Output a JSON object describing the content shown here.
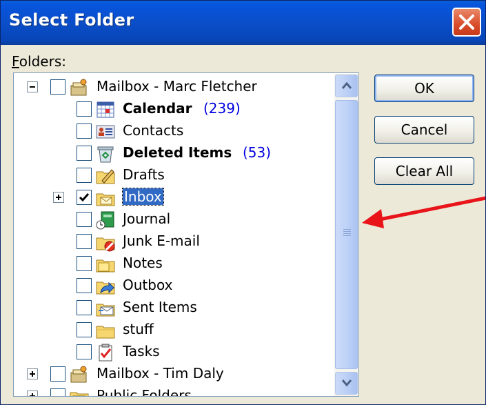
{
  "window": {
    "title": "Select Folder"
  },
  "folders_label": {
    "accel": "F",
    "rest": "olders:"
  },
  "tree": [
    {
      "label": "Mailbox - Marc Fletcher",
      "count": "",
      "bold": false,
      "expander": "minus",
      "checked": false,
      "level": 0,
      "icon": "mailbox-icon",
      "selected": false
    },
    {
      "label": "Calendar",
      "count": "(239)",
      "bold": true,
      "expander": "",
      "checked": false,
      "level": 1,
      "icon": "calendar-icon",
      "selected": false
    },
    {
      "label": "Contacts",
      "count": "",
      "bold": false,
      "expander": "",
      "checked": false,
      "level": 1,
      "icon": "contacts-icon",
      "selected": false
    },
    {
      "label": "Deleted Items",
      "count": "(53)",
      "bold": true,
      "expander": "",
      "checked": false,
      "level": 1,
      "icon": "trash-icon",
      "selected": false
    },
    {
      "label": "Drafts",
      "count": "",
      "bold": false,
      "expander": "",
      "checked": false,
      "level": 1,
      "icon": "drafts-icon",
      "selected": false
    },
    {
      "label": "Inbox",
      "count": "",
      "bold": false,
      "expander": "plus",
      "checked": true,
      "level": 1,
      "icon": "inbox-icon",
      "selected": true
    },
    {
      "label": "Journal",
      "count": "",
      "bold": false,
      "expander": "",
      "checked": false,
      "level": 1,
      "icon": "journal-icon",
      "selected": false
    },
    {
      "label": "Junk E-mail",
      "count": "",
      "bold": false,
      "expander": "",
      "checked": false,
      "level": 1,
      "icon": "junk-folder-icon",
      "selected": false
    },
    {
      "label": "Notes",
      "count": "",
      "bold": false,
      "expander": "",
      "checked": false,
      "level": 1,
      "icon": "notes-icon",
      "selected": false
    },
    {
      "label": "Outbox",
      "count": "",
      "bold": false,
      "expander": "",
      "checked": false,
      "level": 1,
      "icon": "outbox-icon",
      "selected": false
    },
    {
      "label": "Sent Items",
      "count": "",
      "bold": false,
      "expander": "",
      "checked": false,
      "level": 1,
      "icon": "sent-items-icon",
      "selected": false
    },
    {
      "label": "stuff",
      "count": "",
      "bold": false,
      "expander": "",
      "checked": false,
      "level": 1,
      "icon": "folder-icon",
      "selected": false
    },
    {
      "label": "Tasks",
      "count": "",
      "bold": false,
      "expander": "",
      "checked": false,
      "level": 1,
      "icon": "tasks-icon",
      "selected": false
    },
    {
      "label": "Mailbox - Tim Daly",
      "count": "",
      "bold": false,
      "expander": "plus",
      "checked": false,
      "level": 0,
      "icon": "mailbox-icon",
      "selected": false
    },
    {
      "label": "Public Folders",
      "count": "",
      "bold": false,
      "expander": "plus",
      "checked": false,
      "level": 0,
      "icon": "public-folders-icon",
      "selected": false
    }
  ],
  "buttons": {
    "ok": "OK",
    "cancel": "Cancel",
    "clear_all": "Clear All"
  },
  "colors": {
    "title_bar": "#0a4ec9",
    "selection": "#316ac5",
    "count_text": "#0000e0",
    "annotation_arrow": "#e8141a",
    "close_button": "#d94c2a"
  }
}
